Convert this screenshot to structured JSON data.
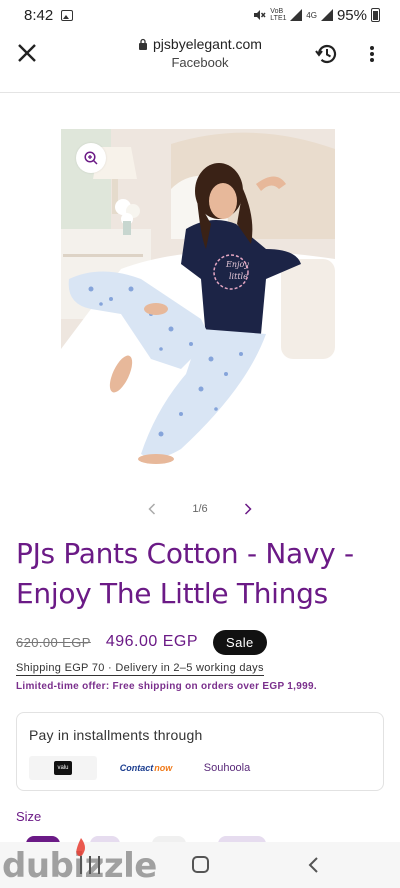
{
  "status_bar": {
    "time": "8:42",
    "network_1": "VoB LTE1",
    "network_2": "4G",
    "battery_percent": "95%",
    "icons": [
      "gallery-icon",
      "mute-icon",
      "signal-icon",
      "battery-icon"
    ]
  },
  "browser": {
    "domain": "pjsbyelegant.com",
    "source": "Facebook",
    "icons": [
      "close-icon",
      "lock-icon",
      "history-icon",
      "more-vertical-icon"
    ]
  },
  "gallery": {
    "counter": "1/6",
    "icons": [
      "zoom-in-icon",
      "chevron-left-icon",
      "chevron-right-icon"
    ]
  },
  "product": {
    "title": "PJs Pants Cotton - Navy - Enjoy The Little Things",
    "old_price": "620.00 EGP",
    "price": "496.00 EGP",
    "badge": "Sale",
    "shipping": "Shipping EGP 70 · Delivery in 2–5 working days",
    "offer": "Limited-time offer: Free shipping on orders over EGP 1,999.",
    "shirt_print": "Enjoy The Little Things"
  },
  "installments": {
    "title": "Pay in installments through",
    "providers": {
      "valu": "valu",
      "contact_a": "Contact",
      "contact_b": "now",
      "souhoola": "Souhoola"
    }
  },
  "size": {
    "label": "Size"
  },
  "watermark": "dubizzle",
  "colors": {
    "accent": "#6b1a86",
    "badge_bg": "#111111",
    "shirt_navy": "#1c2446"
  }
}
